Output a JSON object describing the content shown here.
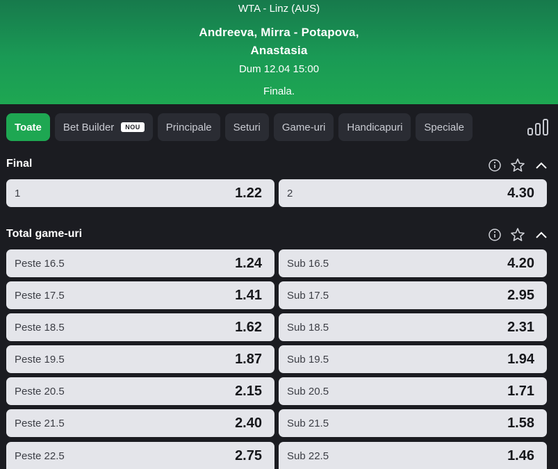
{
  "header": {
    "league": "WTA - Linz (AUS)",
    "teams_line1": "Andreeva, Mirra - Potapova,",
    "teams_line2": "Anastasia",
    "date": "Dum 12.04 15:00",
    "stage": "Finala."
  },
  "tabs": [
    {
      "label": "Toate",
      "active": true
    },
    {
      "label": "Bet Builder",
      "badge": "NOU"
    },
    {
      "label": "Principale"
    },
    {
      "label": "Seturi"
    },
    {
      "label": "Game-uri"
    },
    {
      "label": "Handicapuri"
    },
    {
      "label": "Speciale"
    }
  ],
  "icons": {
    "stats": "bar-chart-icon",
    "info": "info-icon",
    "favorite": "star-icon",
    "collapse": "chevron-up-icon"
  },
  "colors": {
    "accent": "#1ea752",
    "background": "#1b1c21",
    "odd_bg": "#e4e5ea"
  },
  "final": {
    "title": "Final",
    "odds": [
      {
        "label": "1",
        "value": "1.22"
      },
      {
        "label": "2",
        "value": "4.30"
      }
    ]
  },
  "total_games": {
    "title": "Total game-uri",
    "rows": [
      {
        "over_label": "Peste 16.5",
        "over_value": "1.24",
        "under_label": "Sub 16.5",
        "under_value": "4.20"
      },
      {
        "over_label": "Peste 17.5",
        "over_value": "1.41",
        "under_label": "Sub 17.5",
        "under_value": "2.95"
      },
      {
        "over_label": "Peste 18.5",
        "over_value": "1.62",
        "under_label": "Sub 18.5",
        "under_value": "2.31"
      },
      {
        "over_label": "Peste 19.5",
        "over_value": "1.87",
        "under_label": "Sub 19.5",
        "under_value": "1.94"
      },
      {
        "over_label": "Peste 20.5",
        "over_value": "2.15",
        "under_label": "Sub 20.5",
        "under_value": "1.71"
      },
      {
        "over_label": "Peste 21.5",
        "over_value": "2.40",
        "under_label": "Sub 21.5",
        "under_value": "1.58"
      },
      {
        "over_label": "Peste 22.5",
        "over_value": "2.75",
        "under_label": "Sub 22.5",
        "under_value": "1.46"
      }
    ]
  }
}
